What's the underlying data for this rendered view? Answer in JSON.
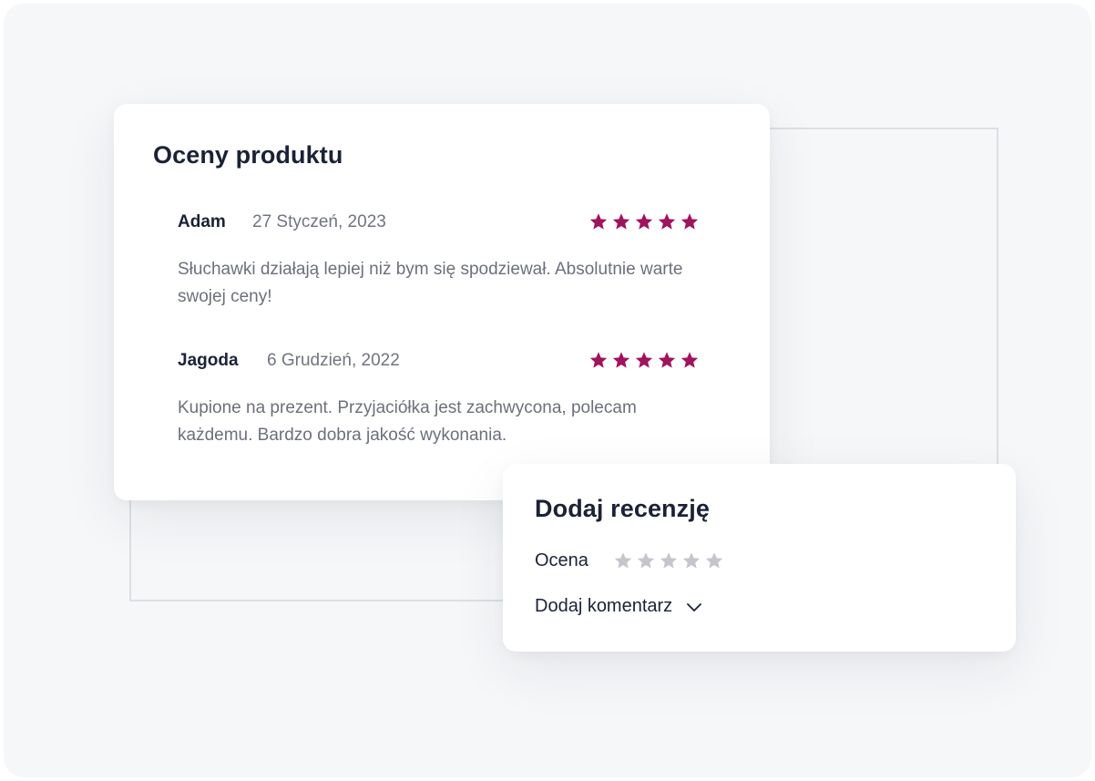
{
  "ratings": {
    "title": "Oceny produktu",
    "star_color": "#a0135e",
    "reviews": [
      {
        "author": "Adam",
        "date": "27 Styczeń, 2023",
        "rating": 5,
        "text": "Słuchawki działają lepiej niż bym się spodziewał. Absolutnie warte swojej ceny!"
      },
      {
        "author": "Jagoda",
        "date": "6 Grudzień, 2022",
        "rating": 5,
        "text": "Kupione na prezent. Przyjaciółka jest zachwycona, polecam każdemu. Bardzo dobra jakość wykonania."
      }
    ]
  },
  "add_review": {
    "title": "Dodaj recenzję",
    "rating_label": "Ocena",
    "rating_value": 0,
    "rating_max": 5,
    "empty_star_color": "#c4c6cc",
    "comment_label": "Dodaj komentarz",
    "comment_icon": "chevron-down-icon"
  }
}
